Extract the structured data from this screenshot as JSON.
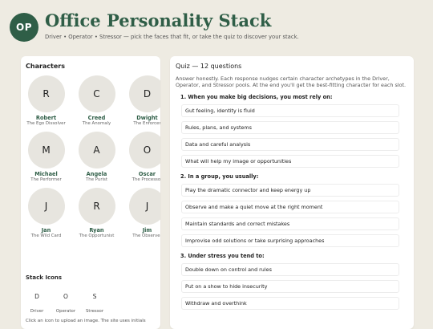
{
  "header": {
    "logo_initials": "OP",
    "title": "Office Personality Stack",
    "subtitle": "Driver • Operator • Stressor — pick the faces that fit, or take the quiz to discover your stack."
  },
  "characters_panel": {
    "heading": "Characters",
    "characters": [
      {
        "initial": "R",
        "name": "Robert",
        "role": "The Ego Dissolver"
      },
      {
        "initial": "C",
        "name": "Creed",
        "role": "The Anomaly"
      },
      {
        "initial": "D",
        "name": "Dwight",
        "role": "The Enforcer"
      },
      {
        "initial": "M",
        "name": "Michael",
        "role": "The Performer"
      },
      {
        "initial": "A",
        "name": "Angela",
        "role": "The Purist"
      },
      {
        "initial": "O",
        "name": "Oscar",
        "role": "The Processor"
      },
      {
        "initial": "J",
        "name": "Jan",
        "role": "The Wild Card"
      },
      {
        "initial": "R",
        "name": "Ryan",
        "role": "The Opportunist"
      },
      {
        "initial": "J",
        "name": "Jim",
        "role": "The Observer"
      }
    ],
    "stack_heading": "Stack Icons",
    "stack_icons": [
      {
        "letter": "D",
        "label": "Driver"
      },
      {
        "letter": "O",
        "label": "Operator"
      },
      {
        "letter": "S",
        "label": "Stressor"
      }
    ],
    "hint": "Click an icon to upload an image. The site uses initials"
  },
  "quiz": {
    "heading": "Quiz — 12 questions",
    "intro": "Answer honestly. Each response nudges certain character archetypes in the Driver, Operator, and Stressor pools. At the end you'll get the best-fitting character for each slot.",
    "questions": [
      {
        "text": "1. When you make big decisions, you most rely on:",
        "options": [
          "Gut feeling, identity is fluid",
          "Rules, plans, and systems",
          "Data and careful analysis",
          "What will help my image or opportunities"
        ]
      },
      {
        "text": "2. In a group, you usually:",
        "options": [
          "Play the dramatic connector and keep energy up",
          "Observe and make a quiet move at the right moment",
          "Maintain standards and correct mistakes",
          "Improvise odd solutions or take surprising approaches"
        ]
      },
      {
        "text": "3. Under stress you tend to:",
        "options": [
          "Double down on control and rules",
          "Put on a show to hide insecurity",
          "Withdraw and overthink"
        ]
      }
    ]
  },
  "colors": {
    "accent": "#2f5e47",
    "background": "#eeebe2",
    "circle": "#e7e5df"
  }
}
